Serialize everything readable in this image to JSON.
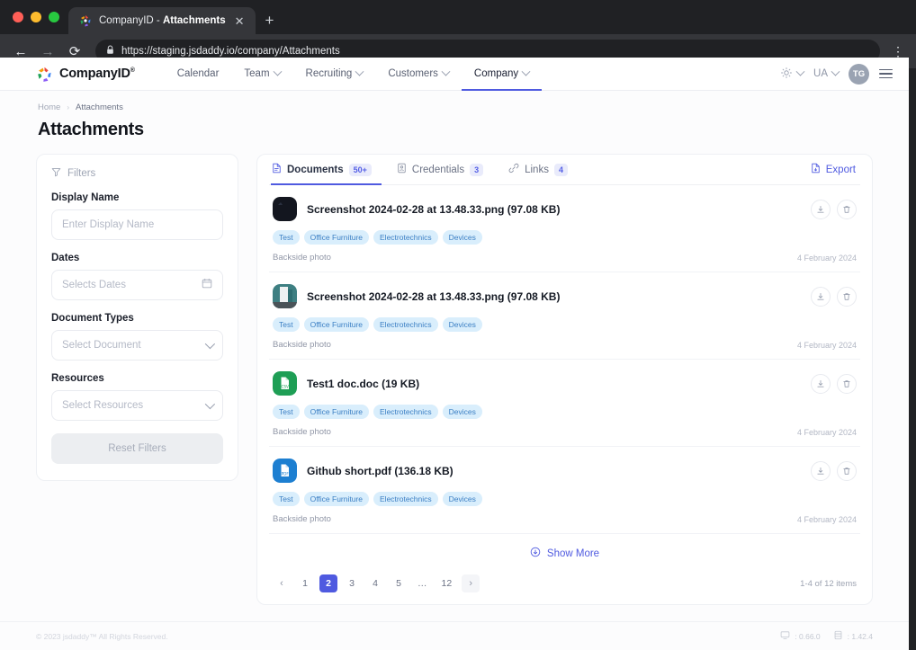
{
  "browser": {
    "tab_title_prefix": "CompanyID - ",
    "tab_title_bold": "Attachments",
    "close_glyph": "✕",
    "newtab_glyph": "+",
    "back_glyph": "←",
    "forward_glyph": "→",
    "reload_glyph": "⟳",
    "lock_glyph": "🔒",
    "url": "https://staging.jsdaddy.io/company/Attachments",
    "menu_glyph": "⋮"
  },
  "header": {
    "brand": "CompanyID",
    "brand_mark": "®",
    "nav": [
      {
        "label": "Calendar",
        "has_chevron": false,
        "active": false
      },
      {
        "label": "Team",
        "has_chevron": true,
        "active": false
      },
      {
        "label": "Recruiting",
        "has_chevron": true,
        "active": false
      },
      {
        "label": "Customers",
        "has_chevron": true,
        "active": false
      },
      {
        "label": "Company",
        "has_chevron": true,
        "active": true
      }
    ],
    "theme_toggle": "sun-icon",
    "language": "UA",
    "avatar_initials": "TG",
    "menu": "hamburger-icon"
  },
  "breadcrumb": {
    "home": "Home",
    "separator": "›",
    "current": "Attachments"
  },
  "page_title": "Attachments",
  "filters": {
    "heading": "Filters",
    "display_name": {
      "label": "Display Name",
      "placeholder": "Enter Display Name",
      "value": ""
    },
    "dates": {
      "label": "Dates",
      "placeholder": "Selects Dates",
      "value": ""
    },
    "document_types": {
      "label": "Document Types",
      "placeholder": "Select Document",
      "value": ""
    },
    "resources": {
      "label": "Resources",
      "placeholder": "Select Resources",
      "value": ""
    },
    "reset_label": "Reset Filters"
  },
  "content": {
    "tabs": [
      {
        "label": "Documents",
        "count": "50+",
        "icon": "document-icon",
        "active": true
      },
      {
        "label": "Credentials",
        "count": "3",
        "icon": "credentials-icon",
        "active": false
      },
      {
        "label": "Links",
        "count": "4",
        "icon": "link-icon",
        "active": false
      }
    ],
    "export_label": "Export",
    "files": [
      {
        "name": "Screenshot 2024-02-28 at 13.48.33.png (97.08 KB)",
        "thumb_type": "image-dark",
        "tags": [
          "Test",
          "Office Furniture",
          "Electrotechnics",
          "Devices"
        ],
        "description": "Backside photo",
        "date": "4 February 2024"
      },
      {
        "name": "Screenshot 2024-02-28 at 13.48.33.png (97.08 KB)",
        "thumb_type": "image-teal",
        "tags": [
          "Test",
          "Office Furniture",
          "Electrotechnics",
          "Devices"
        ],
        "description": "Backside photo",
        "date": "4 February 2024"
      },
      {
        "name": "Test1 doc.doc (19 KB)",
        "thumb_type": "doc-green",
        "thumb_label": "CSV",
        "tags": [
          "Test",
          "Office Furniture",
          "Electrotechnics",
          "Devices"
        ],
        "description": "Backside photo",
        "date": "4 February 2024"
      },
      {
        "name": "Github short.pdf (136.18 KB)",
        "thumb_type": "doc-blue",
        "thumb_label": "PDF",
        "tags": [
          "Test",
          "Office Furniture",
          "Electrotechnics",
          "Devices"
        ],
        "description": "Backside photo",
        "date": "4 February 2024"
      }
    ],
    "show_more": "Show More",
    "pagination": {
      "prev": "‹",
      "next": "›",
      "pages": [
        "1",
        "2",
        "3",
        "4",
        "5",
        "…",
        "12"
      ],
      "active": "2",
      "info": "1-4 of 12 items"
    }
  },
  "footer": {
    "copyright": "© 2023 jsdaddy™  All Rights Reserved.",
    "frontend_version": ": 0.66.0",
    "backend_version": ": 1.42.4"
  },
  "colors": {
    "accent": "#4f5ae0",
    "tag_bg": "#d9eefc",
    "tag_text": "#3b7fc4"
  }
}
